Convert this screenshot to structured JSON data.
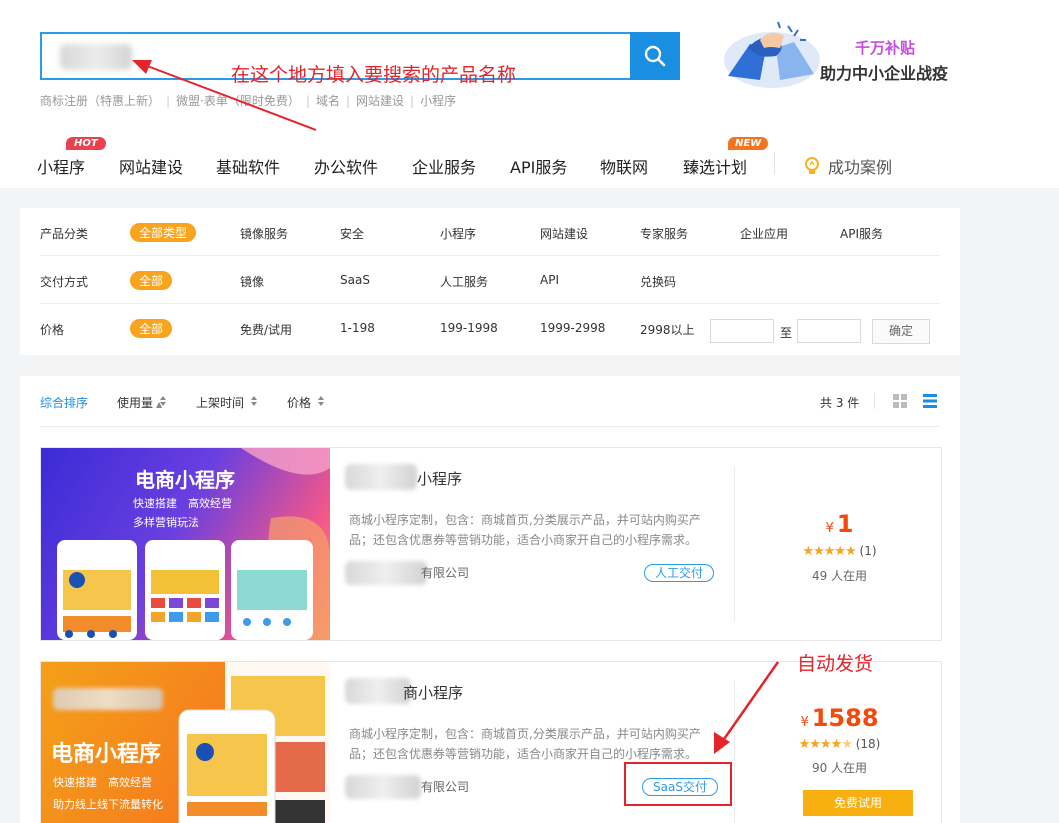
{
  "search": {
    "placeholder": "",
    "button_icon": "search-icon",
    "hot_links": [
      "商标注册（特惠上新）",
      "微盟·表单（限时免费）",
      "域名",
      "网站建设",
      "小程序"
    ]
  },
  "promo": {
    "line1": "千万补贴",
    "line2": "助力中小企业战疫"
  },
  "nav": {
    "items": [
      "小程序",
      "网站建设",
      "基础软件",
      "办公软件",
      "企业服务",
      "API服务",
      "物联网",
      "臻选计划"
    ],
    "hot_badge": "HOT",
    "new_badge": "NEW",
    "success_cases": "成功案例"
  },
  "filters": {
    "category": {
      "label": "产品分类",
      "selected": "全部类型",
      "options": [
        "镜像服务",
        "安全",
        "小程序",
        "网站建设",
        "专家服务",
        "企业应用",
        "API服务"
      ]
    },
    "delivery": {
      "label": "交付方式",
      "selected": "全部",
      "options": [
        "镜像",
        "SaaS",
        "人工服务",
        "API",
        "兑换码"
      ]
    },
    "price": {
      "label": "价格",
      "selected": "全部",
      "options": [
        "免费/试用",
        "1-198",
        "199-1998",
        "1999-2998",
        "2998以上"
      ],
      "to_label": "至",
      "confirm": "确定"
    }
  },
  "sort": {
    "items": [
      "综合排序",
      "使用量",
      "上架时间",
      "价格"
    ],
    "total": "共 3 件"
  },
  "products": [
    {
      "banner_title": "电商小程序",
      "banner_lines": [
        "快速搭建　高效经营",
        "多样营销玩法"
      ],
      "title_suffix": "小程序",
      "desc": "商城小程序定制，包含：商城首页,分类展示产品，并可站内购买产品；还包含优惠券等营销功能，适合小商家开自己的小程序需求。",
      "company_suffix": "有限公司",
      "delivery_tag": "人工交付",
      "currency": "¥",
      "price": "1",
      "rating_count": "(1)",
      "rating": 5,
      "users": "49 人在用"
    },
    {
      "banner_title": "电商小程序",
      "banner_lines": [
        "快速搭建　高效经营",
        "助力线上线下流量转化"
      ],
      "title_suffix": "商小程序",
      "desc": "商城小程序定制，包含：商城首页,分类展示产品，并可站内购买产品；还包含优惠券等营销功能，适合小商家开自己的小程序需求。",
      "company_suffix": "有限公司",
      "delivery_tag": "SaaS交付",
      "currency": "¥",
      "price": "1588",
      "rating_count": "(18)",
      "rating": 4.5,
      "users": "90 人在用",
      "trial_button": "免费试用"
    }
  ],
  "annotations": {
    "search_hint": "在这个地方填入要搜索的产品名称",
    "auto_ship": "自动发货",
    "color": "#e5232b"
  },
  "colors": {
    "accent_blue": "#1a8ee1",
    "accent_orange": "#f8a41e",
    "price_red": "#f5480b"
  }
}
